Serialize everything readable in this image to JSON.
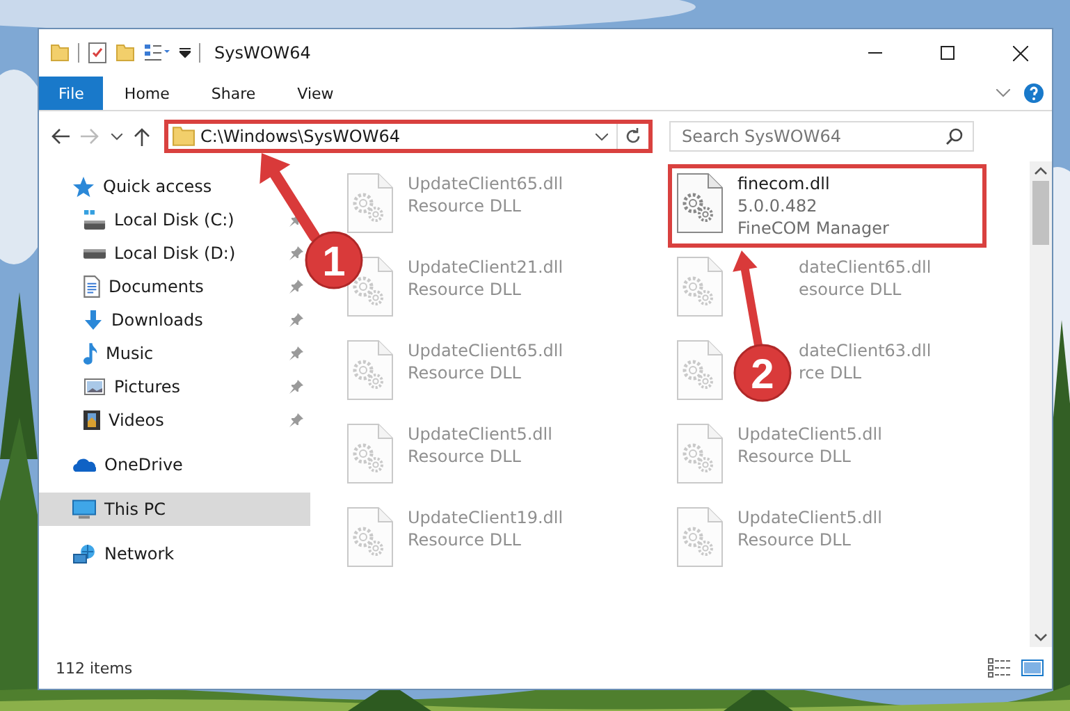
{
  "window": {
    "title": "SysWOW64"
  },
  "ribbon_tabs": [
    {
      "label": "File",
      "kind": "file"
    },
    {
      "label": "Home",
      "kind": "tab"
    },
    {
      "label": "Share",
      "kind": "tab"
    },
    {
      "label": "View",
      "kind": "tab"
    }
  ],
  "address": {
    "path": "C:\\Windows\\SysWOW64",
    "highlighted": true
  },
  "search": {
    "placeholder": "Search SysWOW64"
  },
  "sidebar": {
    "items": [
      {
        "label": "Quick access",
        "kind": "star",
        "selected": false,
        "children": [
          {
            "label": "Local Disk (C:)",
            "kind": "system-drive",
            "pinned": true,
            "selected": false
          },
          {
            "label": "Local Disk (D:)",
            "kind": "drive",
            "pinned": true,
            "selected": false
          },
          {
            "label": "Documents",
            "kind": "documents",
            "pinned": true,
            "selected": false
          },
          {
            "label": "Downloads",
            "kind": "downloads",
            "pinned": true,
            "selected": false
          },
          {
            "label": "Music",
            "kind": "music",
            "pinned": true,
            "selected": false
          },
          {
            "label": "Pictures",
            "kind": "pictures",
            "pinned": true,
            "selected": false
          },
          {
            "label": "Videos",
            "kind": "videos",
            "pinned": true,
            "selected": false
          }
        ]
      },
      {
        "label": "OneDrive",
        "kind": "cloud",
        "selected": false
      },
      {
        "label": "This PC",
        "kind": "computer",
        "selected": true
      },
      {
        "label": "Network",
        "kind": "network",
        "selected": false
      }
    ]
  },
  "files": [
    {
      "name": "UpdateClient65.dll",
      "details": [
        "Resource DLL"
      ],
      "faded": true,
      "highlighted": false
    },
    {
      "name": "finecom.dll",
      "details": [
        "5.0.0.482",
        "FineCOM Manager"
      ],
      "faded": false,
      "highlighted": true
    },
    {
      "name": "UpdateClient21.dll",
      "details": [
        "Resource DLL"
      ],
      "faded": true,
      "highlighted": false
    },
    {
      "name": "dateClient65.dll",
      "details": [
        "esource DLL"
      ],
      "faded": true,
      "highlighted": false,
      "partly_hidden": true
    },
    {
      "name": "UpdateClient65.dll",
      "details": [
        "Resource DLL"
      ],
      "faded": true,
      "highlighted": false
    },
    {
      "name": "dateClient63.dll",
      "details": [
        "rce DLL"
      ],
      "faded": true,
      "highlighted": false,
      "partly_hidden": true
    },
    {
      "name": "UpdateClient5.dll",
      "details": [
        "Resource DLL"
      ],
      "faded": true,
      "highlighted": false
    },
    {
      "name": "UpdateClient5.dll",
      "details": [
        "Resource DLL"
      ],
      "faded": true,
      "highlighted": false
    },
    {
      "name": "UpdateClient19.dll",
      "details": [
        "Resource DLL"
      ],
      "faded": true,
      "highlighted": false
    },
    {
      "name": "UpdateClient5.dll",
      "details": [
        "Resource DLL"
      ],
      "faded": true,
      "highlighted": false
    }
  ],
  "status_bar": {
    "count": "112 items"
  },
  "callouts": [
    {
      "number": "1"
    },
    {
      "number": "2"
    }
  ]
}
